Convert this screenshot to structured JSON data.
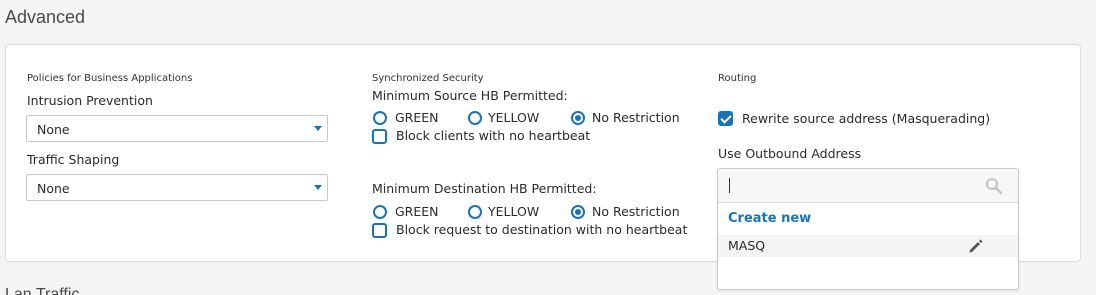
{
  "section_title": "Advanced",
  "next_section_title": "Lan Traffic",
  "business_apps": {
    "heading": "Policies for Business Applications",
    "ips_label": "Intrusion Prevention",
    "ips_value": "None",
    "shaping_label": "Traffic Shaping",
    "shaping_value": "None"
  },
  "sync_security": {
    "heading": "Synchronized Security",
    "source_label": "Minimum Source HB Permitted:",
    "dest_label": "Minimum Destination HB Permitted:",
    "options": [
      "GREEN",
      "YELLOW",
      "No Restriction"
    ],
    "source_selected": "No Restriction",
    "dest_selected": "No Restriction",
    "block_clients_label": "Block clients with no heartbeat",
    "block_clients_checked": false,
    "block_request_label": "Block request to destination with no heartbeat",
    "block_request_checked": false
  },
  "routing": {
    "heading": "Routing",
    "masquerade_label": "Rewrite source address (Masquerading)",
    "masquerade_checked": true,
    "outbound_label": "Use Outbound Address",
    "search_value": "",
    "create_new_label": "Create new",
    "items": [
      "MASQ"
    ]
  },
  "colors": {
    "accent": "#1a73b8",
    "panel_border": "#dcdcdc",
    "page_bg": "#f4f4f4"
  }
}
